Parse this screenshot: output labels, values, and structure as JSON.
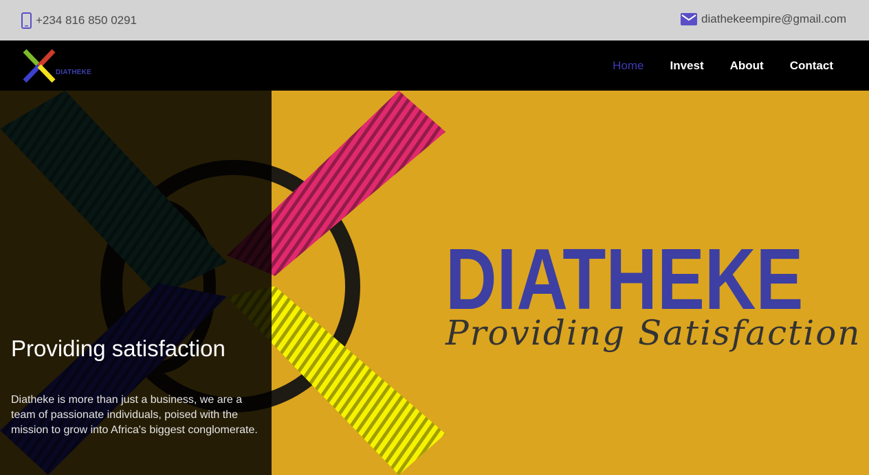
{
  "topbar": {
    "phone": "+234 816 850 0291",
    "email": "diathekeempire@gmail.com"
  },
  "navbar": {
    "logo_text": "DIATHEKE",
    "links": [
      {
        "label": "Home",
        "active": true
      },
      {
        "label": "Invest",
        "active": false
      },
      {
        "label": "About",
        "active": false
      },
      {
        "label": "Contact",
        "active": false
      }
    ]
  },
  "hero": {
    "title": "Providing satisfaction",
    "text": "Diatheke is more than just a business, we are a team of passionate individuals, poised with the mission to grow into Africa's biggest conglomerate.",
    "brand_name": "DIATHEKE",
    "brand_tagline": "Providing Satisfaction"
  },
  "colors": {
    "topbar_bg": "#d3d3d3",
    "navbar_bg": "#000000",
    "hero_bg": "#dba51f",
    "accent_blue": "#3f3ab5",
    "icon_purple": "#5a4fc7"
  },
  "icons": {
    "phone": "phone-icon",
    "email": "envelope-icon"
  }
}
